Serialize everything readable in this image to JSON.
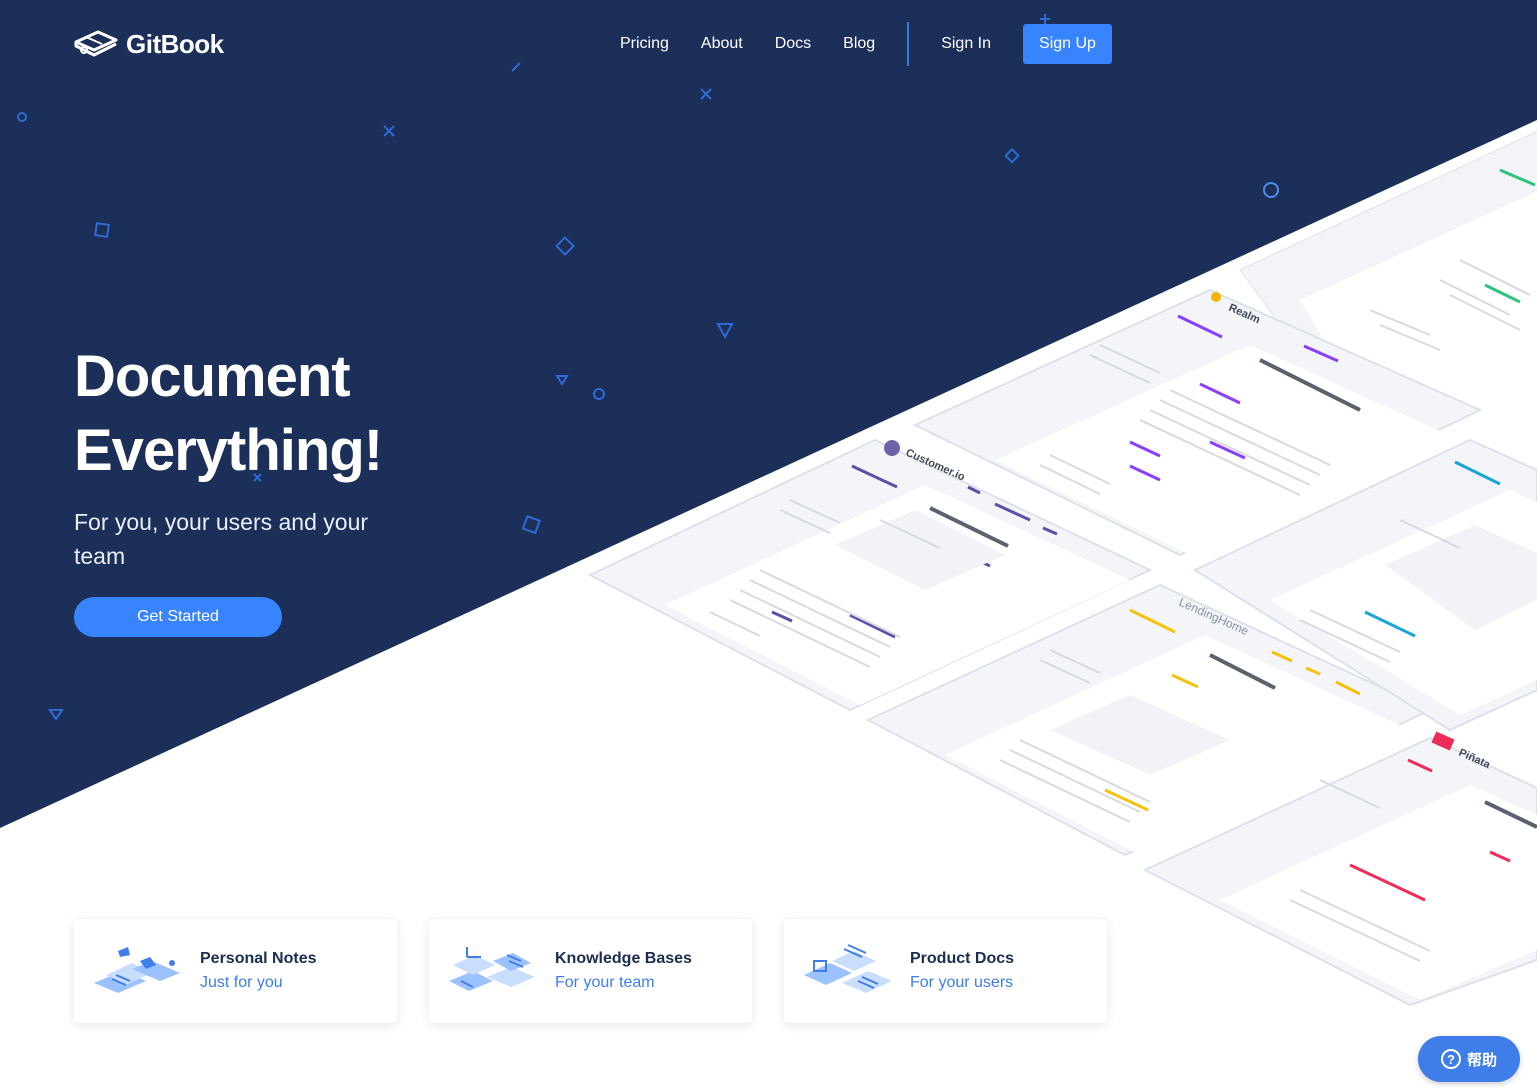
{
  "header": {
    "brand": "GitBook",
    "nav": [
      "Pricing",
      "About",
      "Docs",
      "Blog"
    ],
    "sign_in": "Sign In",
    "sign_up": "Sign Up"
  },
  "hero": {
    "headline_line1": "Document",
    "headline_line2": "Everything!",
    "subheadline": "For you, your users and your team",
    "cta": "Get Started"
  },
  "showcase": {
    "customers": [
      "Realm",
      "Customer.io",
      "LendingHome",
      "Piñata"
    ]
  },
  "cards": [
    {
      "title": "Personal Notes",
      "subtitle": "Just for you"
    },
    {
      "title": "Knowledge Bases",
      "subtitle": "For your team"
    },
    {
      "title": "Product Docs",
      "subtitle": "For your users"
    }
  ],
  "help": {
    "label": "帮助",
    "icon": "?"
  },
  "colors": {
    "navy": "#1b2f58",
    "accent": "#3884ff",
    "card_link": "#3f7ee8"
  },
  "icons": [
    "gitbook-logo-icon",
    "question-icon"
  ]
}
